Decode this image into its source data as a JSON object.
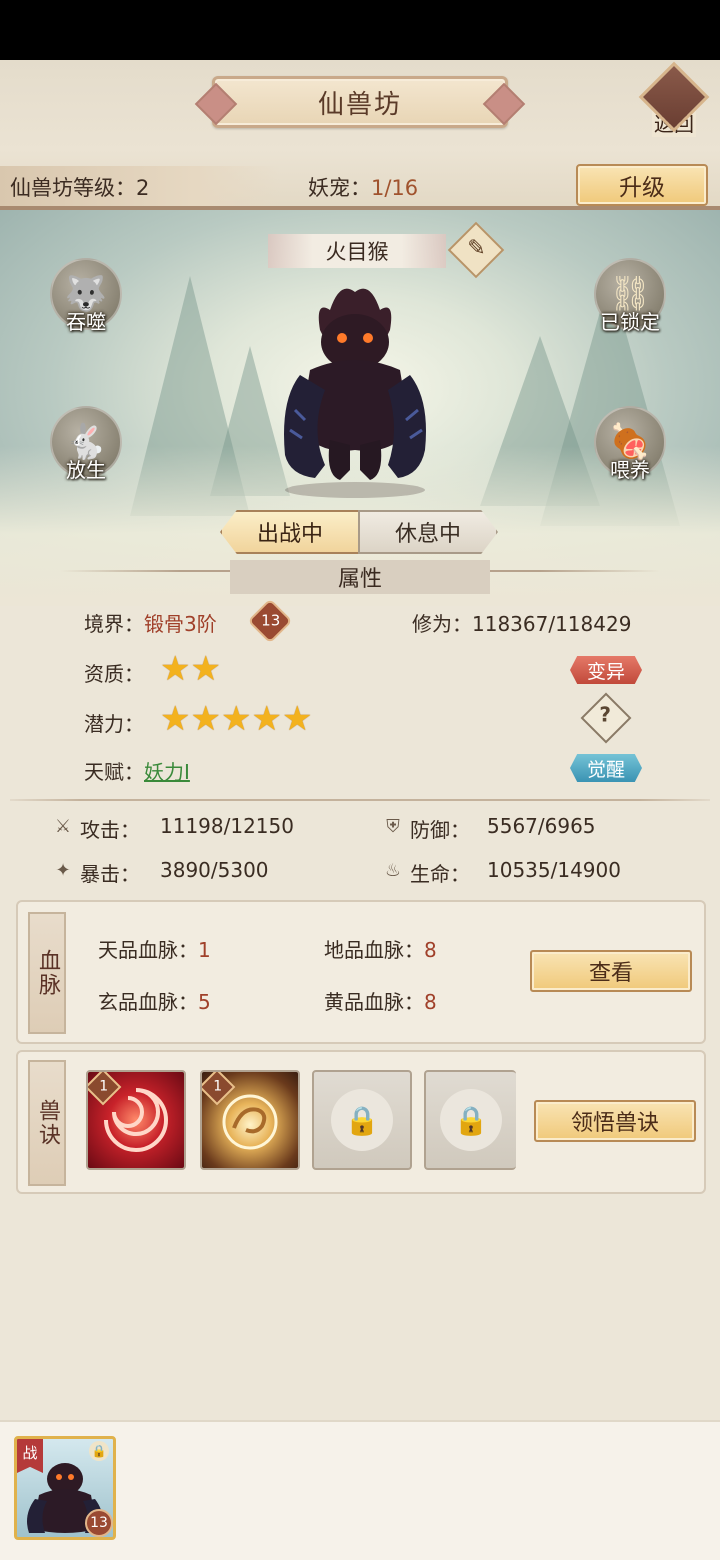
{
  "header": {
    "title": "仙兽坊",
    "back_label": "返回",
    "level_label": "仙兽坊等级：",
    "level_value": "2",
    "pet_label": "妖宠：",
    "pet_count": "1/16",
    "upgrade_label": "升级"
  },
  "pet": {
    "name": "火目猴",
    "actions": {
      "devour": "吞噬",
      "lock": "已锁定",
      "release": "放生",
      "feed": "喂养"
    },
    "tabs": {
      "active": "出战中",
      "inactive": "休息中"
    }
  },
  "attributes": {
    "section_title": "属性",
    "realm_label": "境界：",
    "realm_value": "锻骨3阶",
    "realm_level": "13",
    "cultivation_label": "修为：",
    "cultivation_value": "118367/118429",
    "aptitude_label": "资质：",
    "aptitude_stars": 2,
    "mutate_label": "变异",
    "potential_label": "潜力：",
    "potential_stars": 5,
    "help_label": "?",
    "talent_label": "天赋：",
    "talent_value": "妖力Ⅰ",
    "awaken_label": "觉醒",
    "attack_label": "攻击：",
    "attack_value": "11198/12150",
    "defense_label": "防御：",
    "defense_value": "5567/6965",
    "crit_label": "暴击：",
    "crit_value": "3890/5300",
    "hp_label": "生命：",
    "hp_value": "10535/14900",
    "star_glyph": "★"
  },
  "bloodline": {
    "tab_label": "血脉",
    "heaven_label": "天品血脉：",
    "heaven_value": "1",
    "earth_label": "地品血脉：",
    "earth_value": "8",
    "mystic_label": "玄品血脉：",
    "mystic_value": "5",
    "yellow_label": "黄品血脉：",
    "yellow_value": "8",
    "view_label": "查看"
  },
  "skills": {
    "tab_label": "兽诀",
    "slot1_level": "1",
    "slot2_level": "1",
    "comprehend_label": "领悟兽诀"
  },
  "roster": {
    "battle_flag": "战",
    "pet_level": "13"
  },
  "colors": {
    "accent_gold": "#f0c97a",
    "value_red": "#a0402a",
    "star": "#f3b21e",
    "talent_green": "#3a8a3a",
    "mutate_red": "#c1493a",
    "awaken_blue": "#3a93b3"
  }
}
